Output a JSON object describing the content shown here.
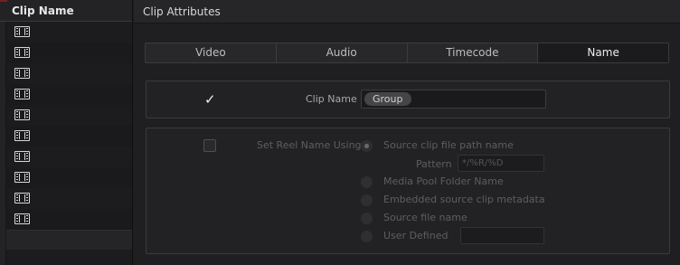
{
  "clip_list": {
    "title": "Clip Name",
    "rows": [
      {
        "icon": "film-clip-icon"
      },
      {
        "icon": "film-clip-icon"
      },
      {
        "icon": "film-clip-icon"
      },
      {
        "icon": "film-clip-icon"
      },
      {
        "icon": "film-clip-icon"
      },
      {
        "icon": "film-clip-icon"
      },
      {
        "icon": "film-clip-icon"
      },
      {
        "icon": "film-clip-icon"
      },
      {
        "icon": "film-clip-icon"
      },
      {
        "icon": "film-clip-icon"
      }
    ]
  },
  "panel": {
    "title": "Clip Attributes",
    "tabs": [
      {
        "label": "Video",
        "active": false
      },
      {
        "label": "Audio",
        "active": false
      },
      {
        "label": "Timecode",
        "active": false
      },
      {
        "label": "Name",
        "active": true
      }
    ]
  },
  "clip_name": {
    "checked": true,
    "check_glyph": "✓",
    "label": "Clip Name",
    "value": "Group"
  },
  "reel_name": {
    "checked": false,
    "label": "Set Reel Name Using",
    "options": [
      {
        "label": "Source clip file path name",
        "selected": true
      },
      {
        "label": "Media Pool Folder Name",
        "selected": false
      },
      {
        "label": "Embedded source clip metadata",
        "selected": false
      },
      {
        "label": "Source file name",
        "selected": false
      },
      {
        "label": "User Defined",
        "selected": false
      }
    ],
    "pattern_label": "Pattern",
    "pattern_value": "*/%R/%D",
    "user_defined_value": ""
  },
  "colors": {
    "background": "#1f1f21",
    "active_tab": "#1b1b1d",
    "accent_red": "#7a1f1f"
  }
}
